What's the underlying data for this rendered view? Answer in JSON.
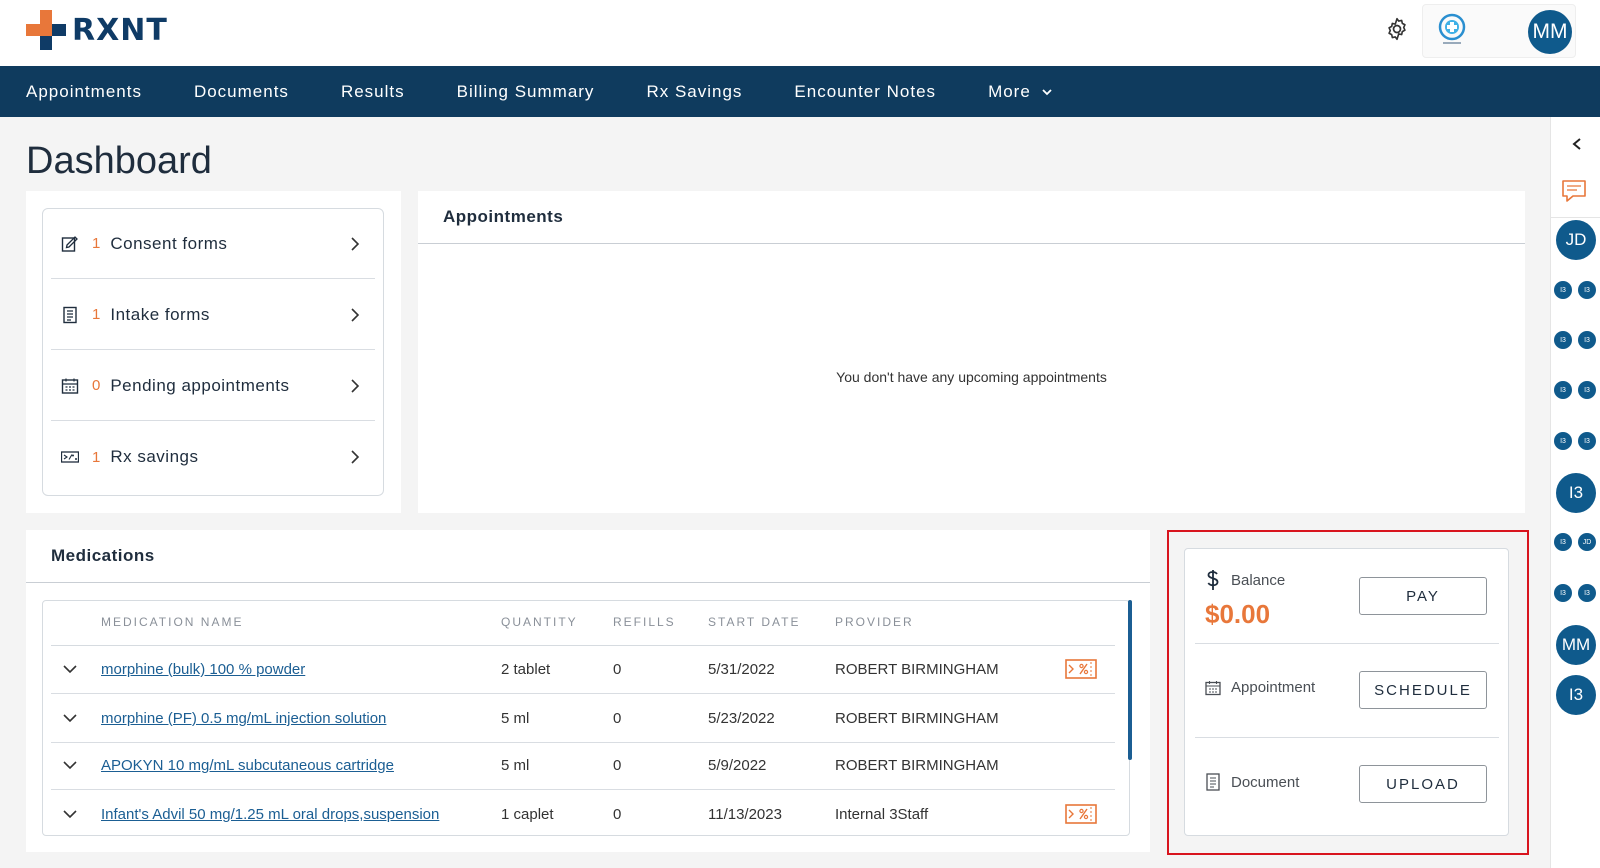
{
  "brand": {
    "name": "RXNT",
    "orange": "#e8773a",
    "navy": "#0f3b5e"
  },
  "header": {
    "settings_icon": "gear-icon",
    "avatar_initials": "MM"
  },
  "nav": {
    "items": [
      {
        "label": "Appointments"
      },
      {
        "label": "Documents"
      },
      {
        "label": "Results"
      },
      {
        "label": "Billing Summary"
      },
      {
        "label": "Rx Savings"
      },
      {
        "label": "Encounter Notes"
      },
      {
        "label": "More"
      }
    ]
  },
  "page": {
    "title": "Dashboard"
  },
  "tasks": [
    {
      "icon": "consent-form-icon",
      "count": "1",
      "label": "Consent forms"
    },
    {
      "icon": "intake-form-icon",
      "count": "1",
      "label": "Intake forms"
    },
    {
      "icon": "calendar-icon",
      "count": "0",
      "label": "Pending appointments"
    },
    {
      "icon": "rx-coupon-icon",
      "count": "1",
      "label": "Rx savings"
    }
  ],
  "appointments": {
    "title": "Appointments",
    "empty_message": "You don't have any upcoming appointments"
  },
  "medications": {
    "title": "Medications",
    "columns": [
      "MEDICATION NAME",
      "QUANTITY",
      "REFILLS",
      "START DATE",
      "PROVIDER"
    ],
    "rows": [
      {
        "name": "morphine (bulk) 100 % powder",
        "quantity": "2 tablet",
        "refills": "0",
        "start_date": "5/31/2022",
        "provider": "ROBERT BIRMINGHAM",
        "rx_savings": true
      },
      {
        "name": "morphine (PF) 0.5 mg/mL injection solution",
        "quantity": "5 ml",
        "refills": "0",
        "start_date": "5/23/2022",
        "provider": "ROBERT BIRMINGHAM",
        "rx_savings": false
      },
      {
        "name": "APOKYN 10 mg/mL subcutaneous cartridge",
        "quantity": "5 ml",
        "refills": "0",
        "start_date": "5/9/2022",
        "provider": "ROBERT BIRMINGHAM",
        "rx_savings": false
      },
      {
        "name": "Infant's Advil 50 mg/1.25 mL oral drops,suspension",
        "quantity": "1 caplet",
        "refills": "0",
        "start_date": "11/13/2023",
        "provider": "Internal 3Staff",
        "rx_savings": true
      }
    ]
  },
  "actions": {
    "balance_label": "Balance",
    "balance_value": "$0.00",
    "pay_label": "PAY",
    "appointment_label": "Appointment",
    "schedule_label": "SCHEDULE",
    "document_label": "Document",
    "upload_label": "UPLOAD"
  },
  "side_panel": {
    "avatars": [
      "JD",
      "I3",
      "MM",
      "I3"
    ],
    "small_avatars": [
      [
        "I3",
        "I3"
      ],
      [
        "I3",
        "I3"
      ],
      [
        "I3",
        "I3"
      ],
      [
        "I3",
        "I3"
      ],
      [
        "I3",
        "JD"
      ],
      [
        "I3",
        "I3"
      ]
    ]
  }
}
